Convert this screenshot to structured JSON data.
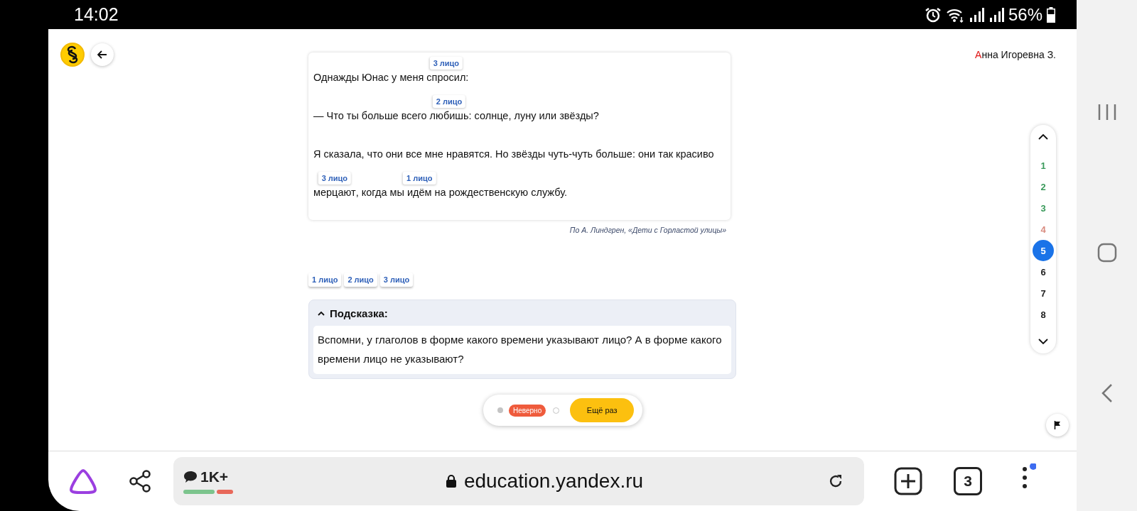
{
  "status_bar": {
    "time": "14:02",
    "battery": "56%"
  },
  "header": {
    "user_name": "Анна Игоревна З."
  },
  "text_card": {
    "lines": [
      [
        {
          "text": "Однажды Юнас у меня "
        },
        {
          "text": "спросил",
          "label": "3 лицо"
        },
        {
          "text": ":"
        }
      ],
      [
        {
          "text": "— Что ты больше всего "
        },
        {
          "text": "любишь",
          "label": "2 лицо"
        },
        {
          "text": ": солнце, луну или звёзды?"
        }
      ],
      [
        {
          "text": "Я сказала, что они все мне нравятся. Но звёзды чуть-чуть больше: они так красиво"
        }
      ],
      [
        {
          "text": "мерцают",
          "label": "3 лицо"
        },
        {
          "text": ", когда мы "
        },
        {
          "text": "идём",
          "label": "1 лицо"
        },
        {
          "text": " на рождественскую службу."
        }
      ]
    ],
    "source": "По А. Линдгрен, «Дети с Горластой улицы»"
  },
  "chips": [
    "1 лицо",
    "2 лицо",
    "3 лицо"
  ],
  "hint": {
    "title": "Подсказка:",
    "expanded": true,
    "text": "Вспомни, у глаголов в форме какого времени указывают лицо? А в форме какого времени лицо не указывают?"
  },
  "result": {
    "badge": "Неверно",
    "retry": "Ещё раз"
  },
  "task_nav": {
    "items": [
      {
        "label": "1",
        "color": "#3a9a5b",
        "selected": false
      },
      {
        "label": "2",
        "color": "#3a9a5b",
        "selected": false
      },
      {
        "label": "3",
        "color": "#3a9a5b",
        "selected": false
      },
      {
        "label": "4",
        "color": "#d88a7e",
        "selected": false
      },
      {
        "label": "5",
        "color": "#1a73e8",
        "selected": true
      },
      {
        "label": "6",
        "color": "#222222",
        "selected": false
      },
      {
        "label": "7",
        "color": "#222222",
        "selected": false
      },
      {
        "label": "8",
        "color": "#222222",
        "selected": false
      }
    ]
  },
  "browser": {
    "comments": "1K+",
    "url": "education.yandex.ru",
    "tabs": "3"
  }
}
